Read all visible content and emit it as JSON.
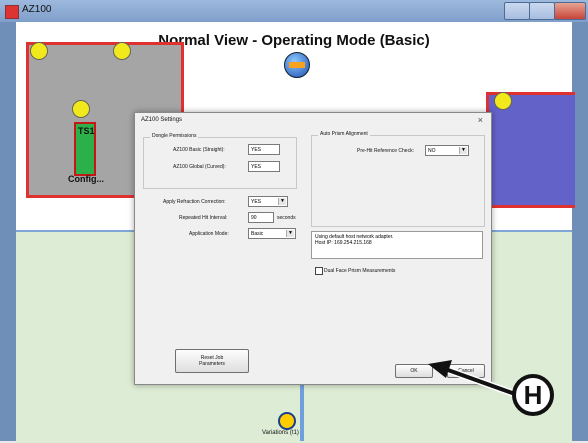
{
  "window": {
    "title": "AZ100"
  },
  "canvas": {
    "title": "Normal View - Operating Mode (Basic)",
    "station_label": "TS1",
    "config_label": "Config...",
    "variations_label": "Variations (t1)"
  },
  "dialog": {
    "title": "AZ100 Settings",
    "close_glyph": "×",
    "dongle_group": "Dongle Permissions",
    "basic_label": "AZ100 Basic (Straight):",
    "basic_value": "YES",
    "global_label": "AZ100 Global (Curved):",
    "global_value": "YES",
    "refraction_label": "Apply Refraction Correction:",
    "refraction_value": "YES",
    "interval_label": "Repeated Hit Interval:",
    "interval_value": "90",
    "interval_unit": "seconds",
    "mode_label": "Application Mode:",
    "mode_value": "Basic",
    "prism_group": "Auto Prism Alignment",
    "prehit_label": "Pre-Hit Reference Check:",
    "prehit_value": "NO",
    "network_line1": "Using default host network adapter.",
    "network_line2": "Host IP: 169.254.215.168",
    "dual_face_label": "Dual Face Prism Measurements",
    "reset_label_1": "Reset Job",
    "reset_label_2": "Parameters",
    "ok_label": "OK",
    "cancel_label": "Cancel",
    "dropdown_glyph": "▼"
  },
  "callout": {
    "letter": "H"
  },
  "colors": {
    "zone_border": "#e03131",
    "yellow_marker": "#f2e91c",
    "blue_zone": "#6262c8",
    "lower_area": "#ddecd4",
    "station_fill": "#2cb14a"
  },
  "icons": [
    "app-icon",
    "compass-icon",
    "yellow-marker-icon",
    "variations-icon",
    "dropdown-arrow-icon",
    "close-icon"
  ]
}
